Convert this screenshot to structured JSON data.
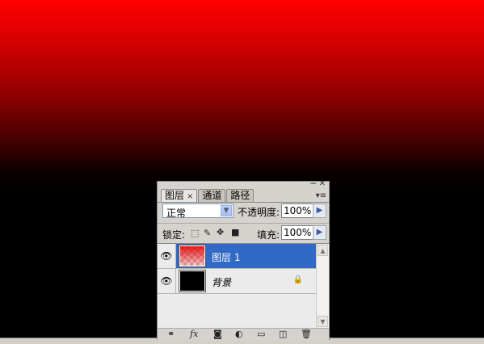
{
  "layers_panel": {
    "tabs": [
      {
        "label": "图层",
        "close": "×",
        "active": true
      },
      {
        "label": "通道",
        "active": false
      },
      {
        "label": "路径",
        "active": false
      }
    ],
    "title_minimize": "─",
    "title_close": "✕",
    "menu_glyph": "▾≡",
    "blend_mode": "正常",
    "opacity_label": "不透明度:",
    "opacity_value": "100%",
    "lock_label": "锁定:",
    "fill_label": "填充:",
    "fill_value": "100%",
    "layers": [
      {
        "name": "图层 1",
        "selected": true,
        "visible": true,
        "thumbnail": "red-gradient"
      },
      {
        "name": "背景",
        "selected": false,
        "visible": true,
        "locked": true,
        "thumbnail": "black"
      }
    ],
    "bottom_icons": [
      "link-icon",
      "fx-icon",
      "mask-icon",
      "adjustment-icon",
      "group-icon",
      "new-layer-icon",
      "trash-icon"
    ],
    "fx_label": "fx"
  },
  "canvas": {
    "gradient_colors": [
      "#ff0000",
      "#000000"
    ]
  }
}
